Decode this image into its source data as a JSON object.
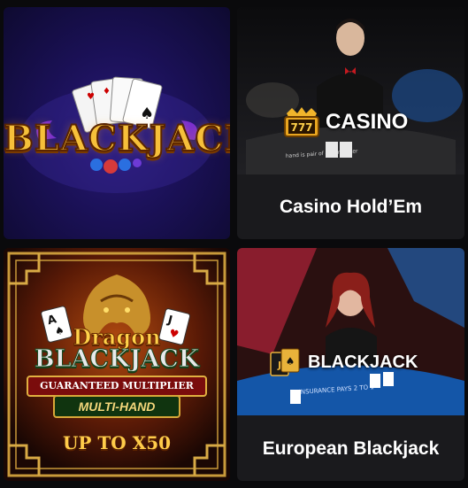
{
  "tiles": [
    {
      "id": "blackjack",
      "logo_text": "BLACKJACK"
    },
    {
      "id": "casino-holdem",
      "badge": "CASINO",
      "badge_icon": "777",
      "caption": "Casino Hold’Em"
    },
    {
      "id": "dragon-blackjack",
      "line1": "Dragon",
      "line2": "BLACKJACK",
      "line3": "GUARANTEED MULTIPLIER",
      "line4": "MULTI-HAND",
      "line5": "UP TO X50",
      "card_left": "A",
      "card_right": "J"
    },
    {
      "id": "european-blackjack",
      "badge": "BLACKJACK",
      "badge_icon": "J",
      "caption": "European Blackjack"
    }
  ]
}
